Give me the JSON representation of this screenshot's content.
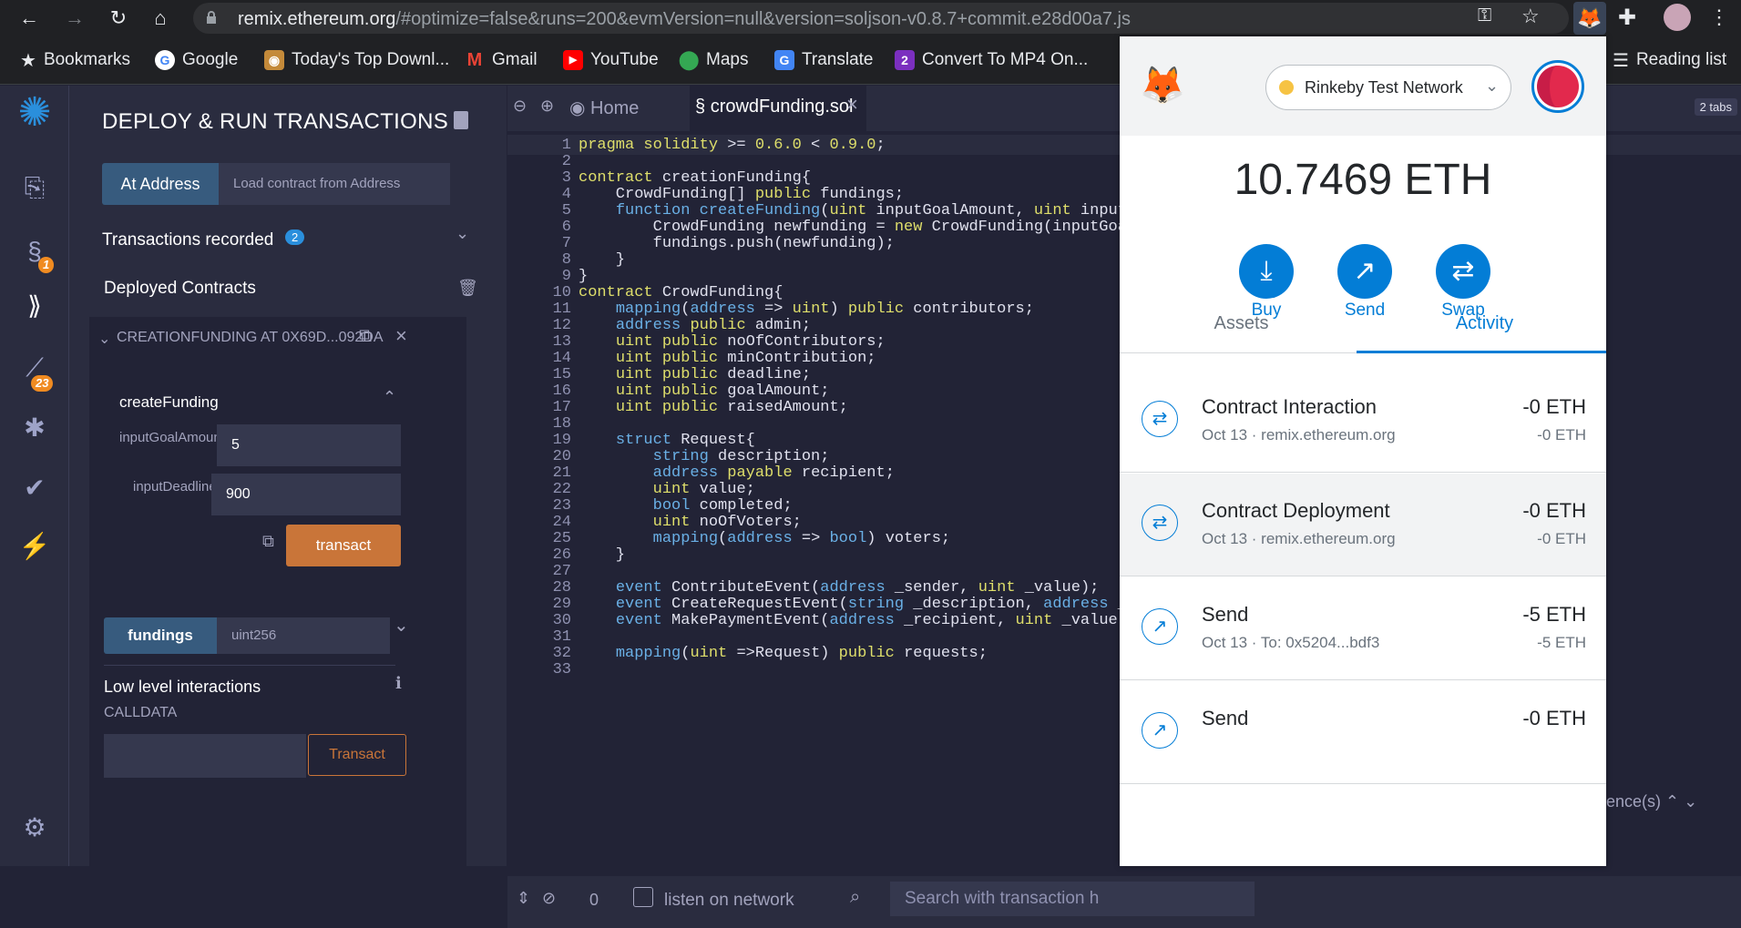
{
  "browser": {
    "url_host": "remix.ethereum.org",
    "url_rest": "/#optimize=false&runs=200&evmVersion=null&version=soljson-v0.8.7+commit.e28d00a7.js",
    "bookmarks": [
      "Bookmarks",
      "Google",
      "Today's Top Downl...",
      "Gmail",
      "YouTube",
      "Maps",
      "Translate",
      "Convert To MP4 On...",
      "Reading list"
    ]
  },
  "remix": {
    "badges": {
      "plugin": "1",
      "analysis": "23"
    },
    "panel_title": "DEPLOY & RUN TRANSACTIONS",
    "at_address_label": "At Address",
    "at_address_placeholder": "Load contract from Address",
    "transactions_recorded": "Transactions recorded",
    "transactions_count": "2",
    "deployed_contracts": "Deployed Contracts",
    "instance_title": "CREATIONFUNDING AT 0X69D...092DA",
    "function_name": "createFunding",
    "params": [
      {
        "label": "inputGoalAmount:",
        "value": "5"
      },
      {
        "label": "inputDeadline:",
        "value": "900"
      }
    ],
    "transact_label": "transact",
    "fundings_label": "fundings",
    "fundings_placeholder": "uint256",
    "low_level": "Low level interactions",
    "calldata": "CALLDATA",
    "transact2": "Transact"
  },
  "editor": {
    "tabs": [
      "Home",
      "crowdFunding.sol"
    ],
    "tabs_count": "2 tabs",
    "line_numbers": [
      "1",
      "2",
      "3",
      "4",
      "5",
      "6",
      "7",
      "8",
      "9",
      "10",
      "11",
      "12",
      "13",
      "14",
      "15",
      "16",
      "17",
      "18",
      "19",
      "20",
      "21",
      "22",
      "23",
      "24",
      "25",
      "26",
      "27",
      "28",
      "29",
      "30",
      "31",
      "32",
      "33"
    ],
    "bottom": {
      "count": "0",
      "listen": "listen on network",
      "search_placeholder": "Search with transaction h",
      "reference": "erence(s)"
    }
  },
  "metamask": {
    "network": "Rinkeby Test Network",
    "balance": "10.7469 ETH",
    "actions": [
      "Buy",
      "Send",
      "Swap"
    ],
    "tabs": [
      "Assets",
      "Activity"
    ],
    "transactions": [
      {
        "title": "Contract Interaction",
        "sub": "Oct 13 · remix.ethereum.org",
        "amount": "-0 ETH",
        "amount2": "-0 ETH"
      },
      {
        "title": "Contract Deployment",
        "sub": "Oct 13 · remix.ethereum.org",
        "amount": "-0 ETH",
        "amount2": "-0 ETH"
      },
      {
        "title": "Send",
        "sub": "Oct 13 · To: 0x5204...bdf3",
        "amount": "-5 ETH",
        "amount2": "-5 ETH"
      },
      {
        "title": "Send",
        "amount": "-0 ETH"
      }
    ]
  }
}
